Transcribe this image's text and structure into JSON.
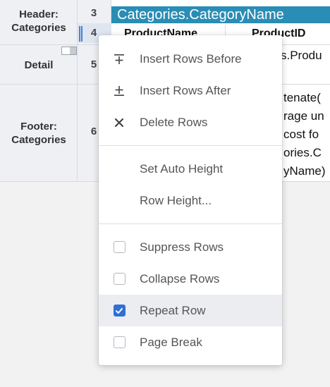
{
  "bands": {
    "header": "Header:\nCategories",
    "detail": "Detail",
    "footer": "Footer:\nCategories"
  },
  "row_numbers": [
    "3",
    "4",
    "5",
    "6"
  ],
  "grid": {
    "category_cell": "Categories.CategoryName",
    "col_product_name": "ProductName",
    "col_product_id": "ProductID",
    "detail_fragment": "s.Produ",
    "footer_lines": [
      "tenate(",
      "rage un",
      " cost fo",
      "ories.C",
      "yName)"
    ]
  },
  "context_menu": {
    "items": [
      {
        "label": "Insert Rows Before",
        "icon": "insert-before-icon"
      },
      {
        "label": "Insert Rows After",
        "icon": "insert-after-icon"
      },
      {
        "label": "Delete Rows",
        "icon": "close-icon"
      }
    ],
    "height_items": [
      {
        "label": "Set Auto Height"
      },
      {
        "label": "Row Height..."
      }
    ],
    "check_items": [
      {
        "label": "Suppress Rows",
        "checked": false
      },
      {
        "label": "Collapse Rows",
        "checked": false
      },
      {
        "label": "Repeat Row",
        "checked": true
      },
      {
        "label": "Page Break",
        "checked": false
      }
    ]
  },
  "colors": {
    "accent": "#2f6fd6",
    "category_header_bg": "#2a8db5"
  }
}
